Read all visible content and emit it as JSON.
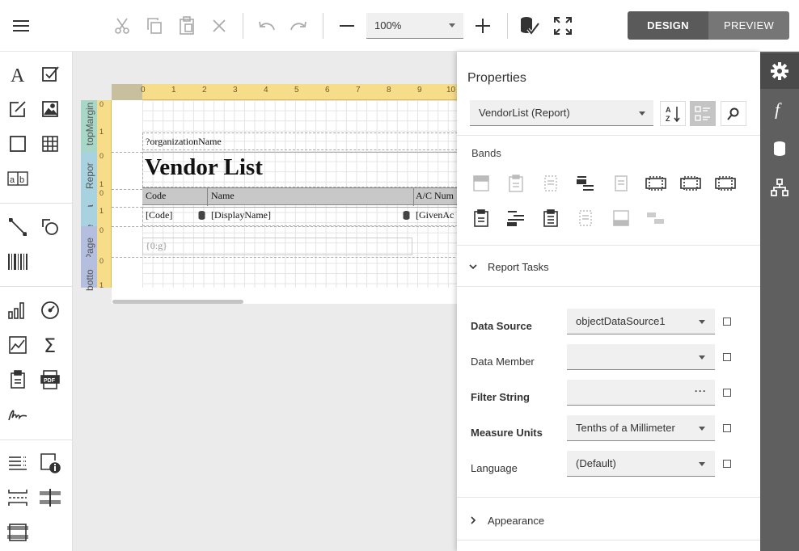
{
  "toolbar": {
    "zoom_value": "100%",
    "design_label": "DESIGN",
    "preview_label": "PREVIEW"
  },
  "report": {
    "ruler_ticks": [
      "0",
      "1",
      "2",
      "3",
      "4",
      "5",
      "6",
      "7",
      "8",
      "9",
      "10"
    ],
    "vruler_ticks": [
      "0",
      "1",
      "0",
      "1",
      "0",
      "1",
      "0",
      "0",
      "0",
      "1"
    ],
    "bands": [
      "topMargin",
      "Repor",
      "Pa",
      "de",
      "Page",
      "botto"
    ],
    "org_field": "?organizationName",
    "title": "Vendor List",
    "col_code": "Code",
    "col_name": "Name",
    "col_ac": "A/C Num",
    "cell_code": "[Code]",
    "cell_name": "[DisplayName]",
    "cell_ac": "[GivenAc",
    "page_info": "{0:g}"
  },
  "properties": {
    "title": "Properties",
    "selected_component": "VendorList (Report)",
    "bands_title": "Bands",
    "report_tasks_label": "Report Tasks",
    "appearance_label": "Appearance",
    "rows": [
      {
        "label": "Data Source",
        "value": "objectDataSource1",
        "bold": true,
        "editor": "dropdown"
      },
      {
        "label": "Data Member",
        "value": "",
        "bold": false,
        "editor": "dropdown"
      },
      {
        "label": "Filter String",
        "value": "",
        "bold": true,
        "editor": "ellipsis"
      },
      {
        "label": "Measure Units",
        "value": "Tenths of a Millimeter",
        "bold": true,
        "editor": "dropdown"
      },
      {
        "label": "Language",
        "value": "(Default)",
        "bold": false,
        "editor": "dropdown"
      }
    ],
    "ellipsis": "···"
  },
  "colors": {
    "accent_dark": "#5a5a5a",
    "sidebar_dark": "#5f5f5f",
    "ruler": "#f7dd8a"
  }
}
